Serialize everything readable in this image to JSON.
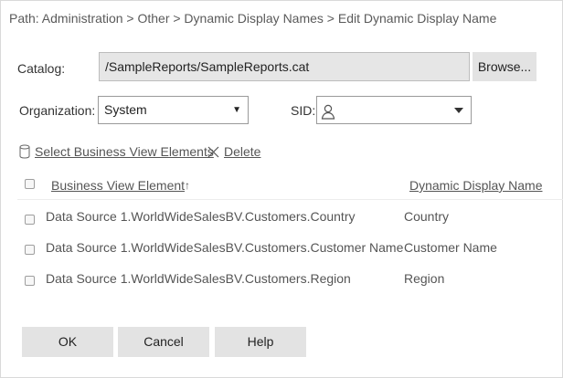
{
  "breadcrumb": "Path: Administration > Other > Dynamic Display Names > Edit Dynamic Display Name",
  "catalog": {
    "label": "Catalog:",
    "value": "/SampleReports/SampleReports.cat",
    "browse_label": "Browse..."
  },
  "organization": {
    "label": "Organization:",
    "selected": "System"
  },
  "sid": {
    "label": "SID:",
    "selected": "",
    "icon": "user-icon"
  },
  "actions": {
    "select_label": "Select Business View Elements",
    "select_icon": "database-icon",
    "delete_label": "Delete",
    "delete_icon": "close-icon"
  },
  "table": {
    "headers": {
      "element": "Business View Element",
      "sort_indicator": "↑",
      "display_name": "Dynamic Display Name"
    },
    "rows": [
      {
        "element": "Data Source 1.WorldWideSalesBV.Customers.Country",
        "display_name": "Country"
      },
      {
        "element": "Data Source 1.WorldWideSalesBV.Customers.Customer Name",
        "display_name": "Customer Name"
      },
      {
        "element": "Data Source 1.WorldWideSalesBV.Customers.Region",
        "display_name": "Region"
      }
    ]
  },
  "footer": {
    "ok_label": "OK",
    "cancel_label": "Cancel",
    "help_label": "Help"
  },
  "colors": {
    "button_bg": "#e3e3e3",
    "readonly_bg": "#e6e6e6",
    "text": "#333333",
    "link": "#555555"
  }
}
